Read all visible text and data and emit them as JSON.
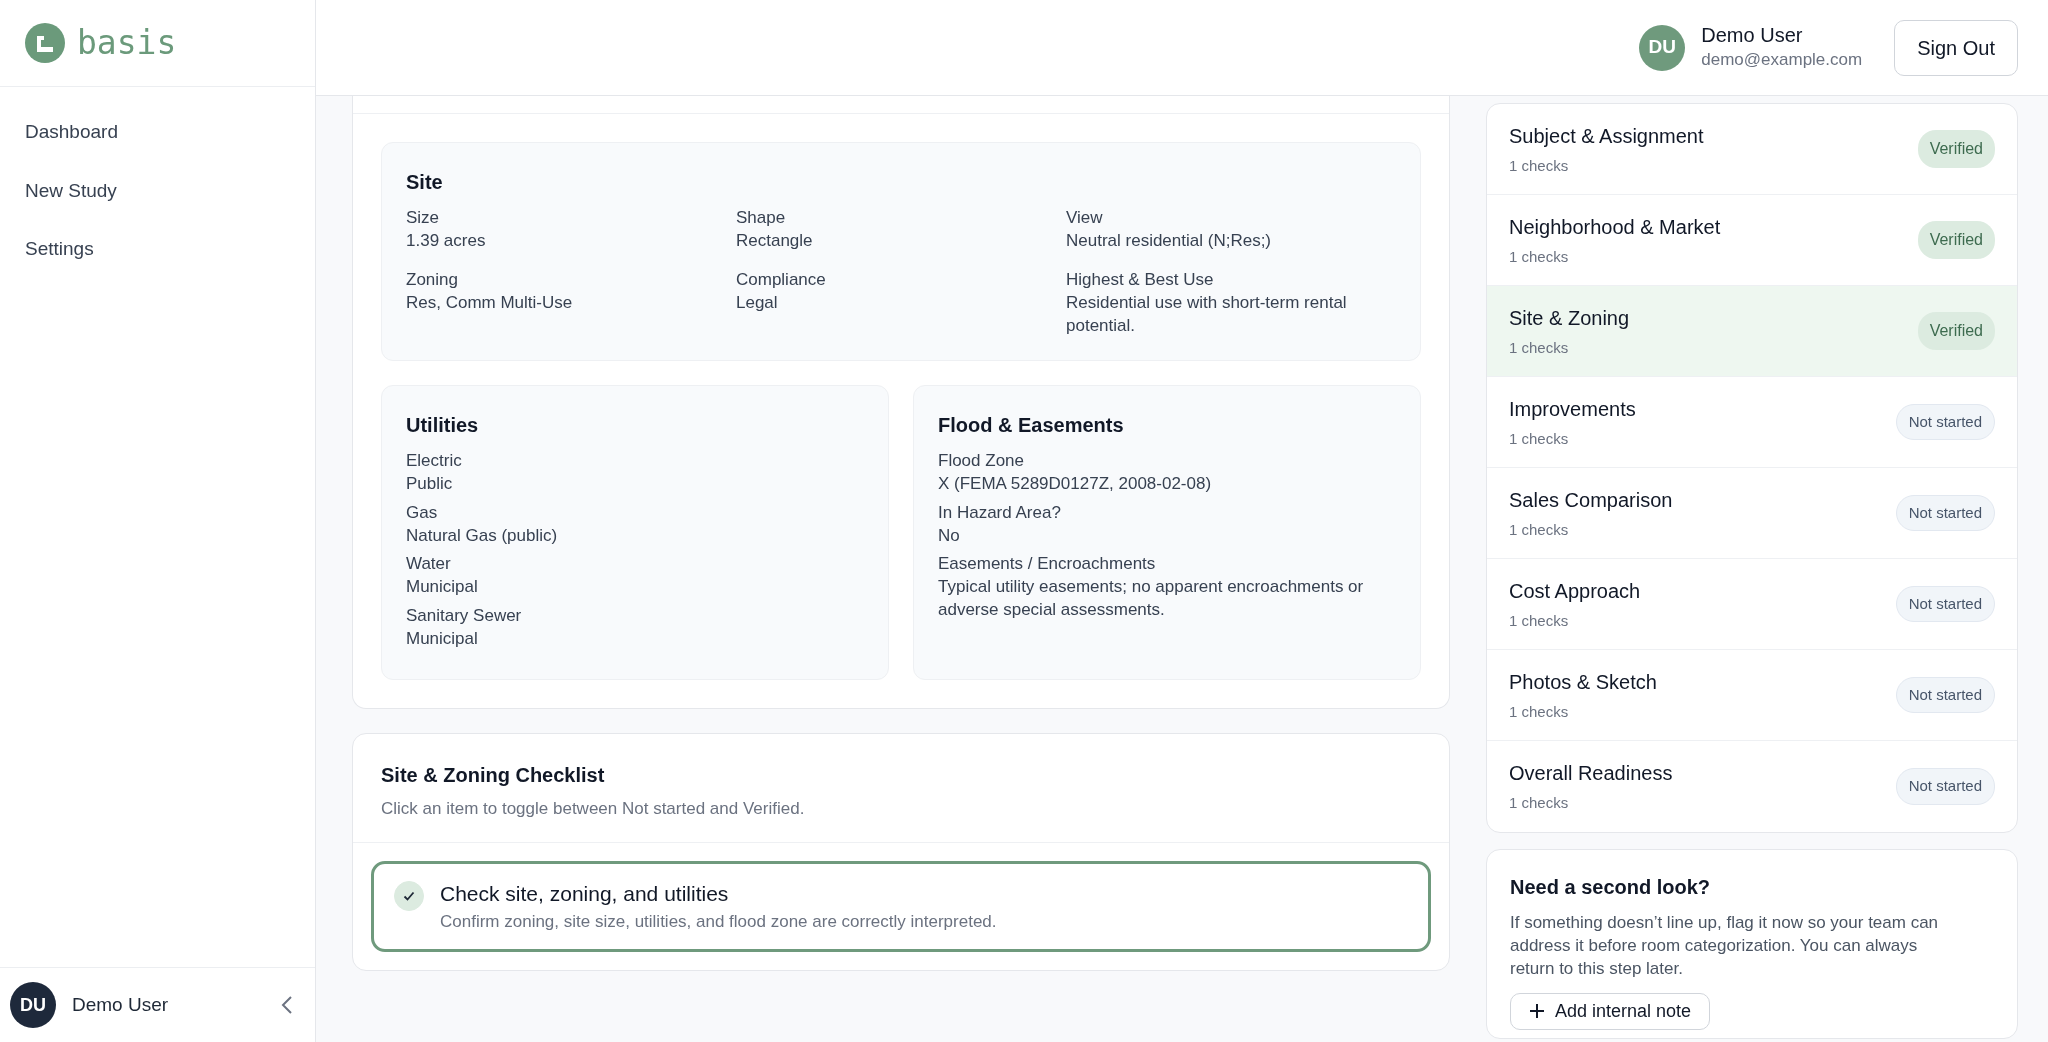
{
  "sidebar": {
    "logo": "basis",
    "items": [
      {
        "label": "Dashboard",
        "selected": false
      },
      {
        "label": "New Study",
        "selected": false
      },
      {
        "label": "Settings",
        "selected": false
      }
    ],
    "user": {
      "initials": "DU",
      "name": "Demo User"
    }
  },
  "header": {
    "user": {
      "initials": "DU",
      "name": "Demo User",
      "email": "demo@example.com"
    },
    "sign_out": "Sign Out"
  },
  "site": {
    "title": "Site",
    "fields": [
      {
        "label": "Size",
        "value": "1.39 acres"
      },
      {
        "label": "Shape",
        "value": "Rectangle"
      },
      {
        "label": "View",
        "value": "Neutral residential (N;Res;)"
      },
      {
        "label": "Zoning",
        "value": "Res, Comm Multi-Use"
      },
      {
        "label": "Compliance",
        "value": "Legal"
      },
      {
        "label": "Highest & Best Use",
        "value": "Residential use with short-term rental potential."
      }
    ]
  },
  "utilities": {
    "title": "Utilities",
    "fields": [
      {
        "label": "Electric",
        "value": "Public"
      },
      {
        "label": "Gas",
        "value": "Natural Gas (public)"
      },
      {
        "label": "Water",
        "value": "Municipal"
      },
      {
        "label": "Sanitary Sewer",
        "value": "Municipal"
      }
    ]
  },
  "flood": {
    "title": "Flood & Easements",
    "fields": [
      {
        "label": "Flood Zone",
        "value": "X (FEMA 5289D0127Z, 2008-02-08)"
      },
      {
        "label": "In Hazard Area?",
        "value": "No"
      },
      {
        "label": "Easements / Encroachments",
        "value": "Typical utility easements; no apparent encroachments or adverse special assessments."
      }
    ]
  },
  "checklist": {
    "title": "Site & Zoning Checklist",
    "subtitle": "Click an item to toggle between Not started and Verified.",
    "items": [
      {
        "title": "Check site, zoning, and utilities",
        "description": "Confirm zoning, site size, utilities, and flood zone are correctly interpreted.",
        "checked": true
      }
    ]
  },
  "steps": [
    {
      "name": "Subject & Assignment",
      "checks": "1 checks",
      "status": "Verified",
      "kind": "verified",
      "selected": false
    },
    {
      "name": "Neighborhood & Market",
      "checks": "1 checks",
      "status": "Verified",
      "kind": "verified",
      "selected": false
    },
    {
      "name": "Site & Zoning",
      "checks": "1 checks",
      "status": "Verified",
      "kind": "verified",
      "selected": true
    },
    {
      "name": "Improvements",
      "checks": "1 checks",
      "status": "Not started",
      "kind": "not_started",
      "selected": false
    },
    {
      "name": "Sales Comparison",
      "checks": "1 checks",
      "status": "Not started",
      "kind": "not_started",
      "selected": false
    },
    {
      "name": "Cost Approach",
      "checks": "1 checks",
      "status": "Not started",
      "kind": "not_started",
      "selected": false
    },
    {
      "name": "Photos & Sketch",
      "checks": "1 checks",
      "status": "Not started",
      "kind": "not_started",
      "selected": false
    },
    {
      "name": "Overall Readiness",
      "checks": "1 checks",
      "status": "Not started",
      "kind": "not_started",
      "selected": false
    }
  ],
  "note_card": {
    "title": "Need a second look?",
    "text": "If something doesn’t line up, flag it now so your team can address it before room categorization. You can always return to this step later.",
    "button": "Add internal note"
  }
}
